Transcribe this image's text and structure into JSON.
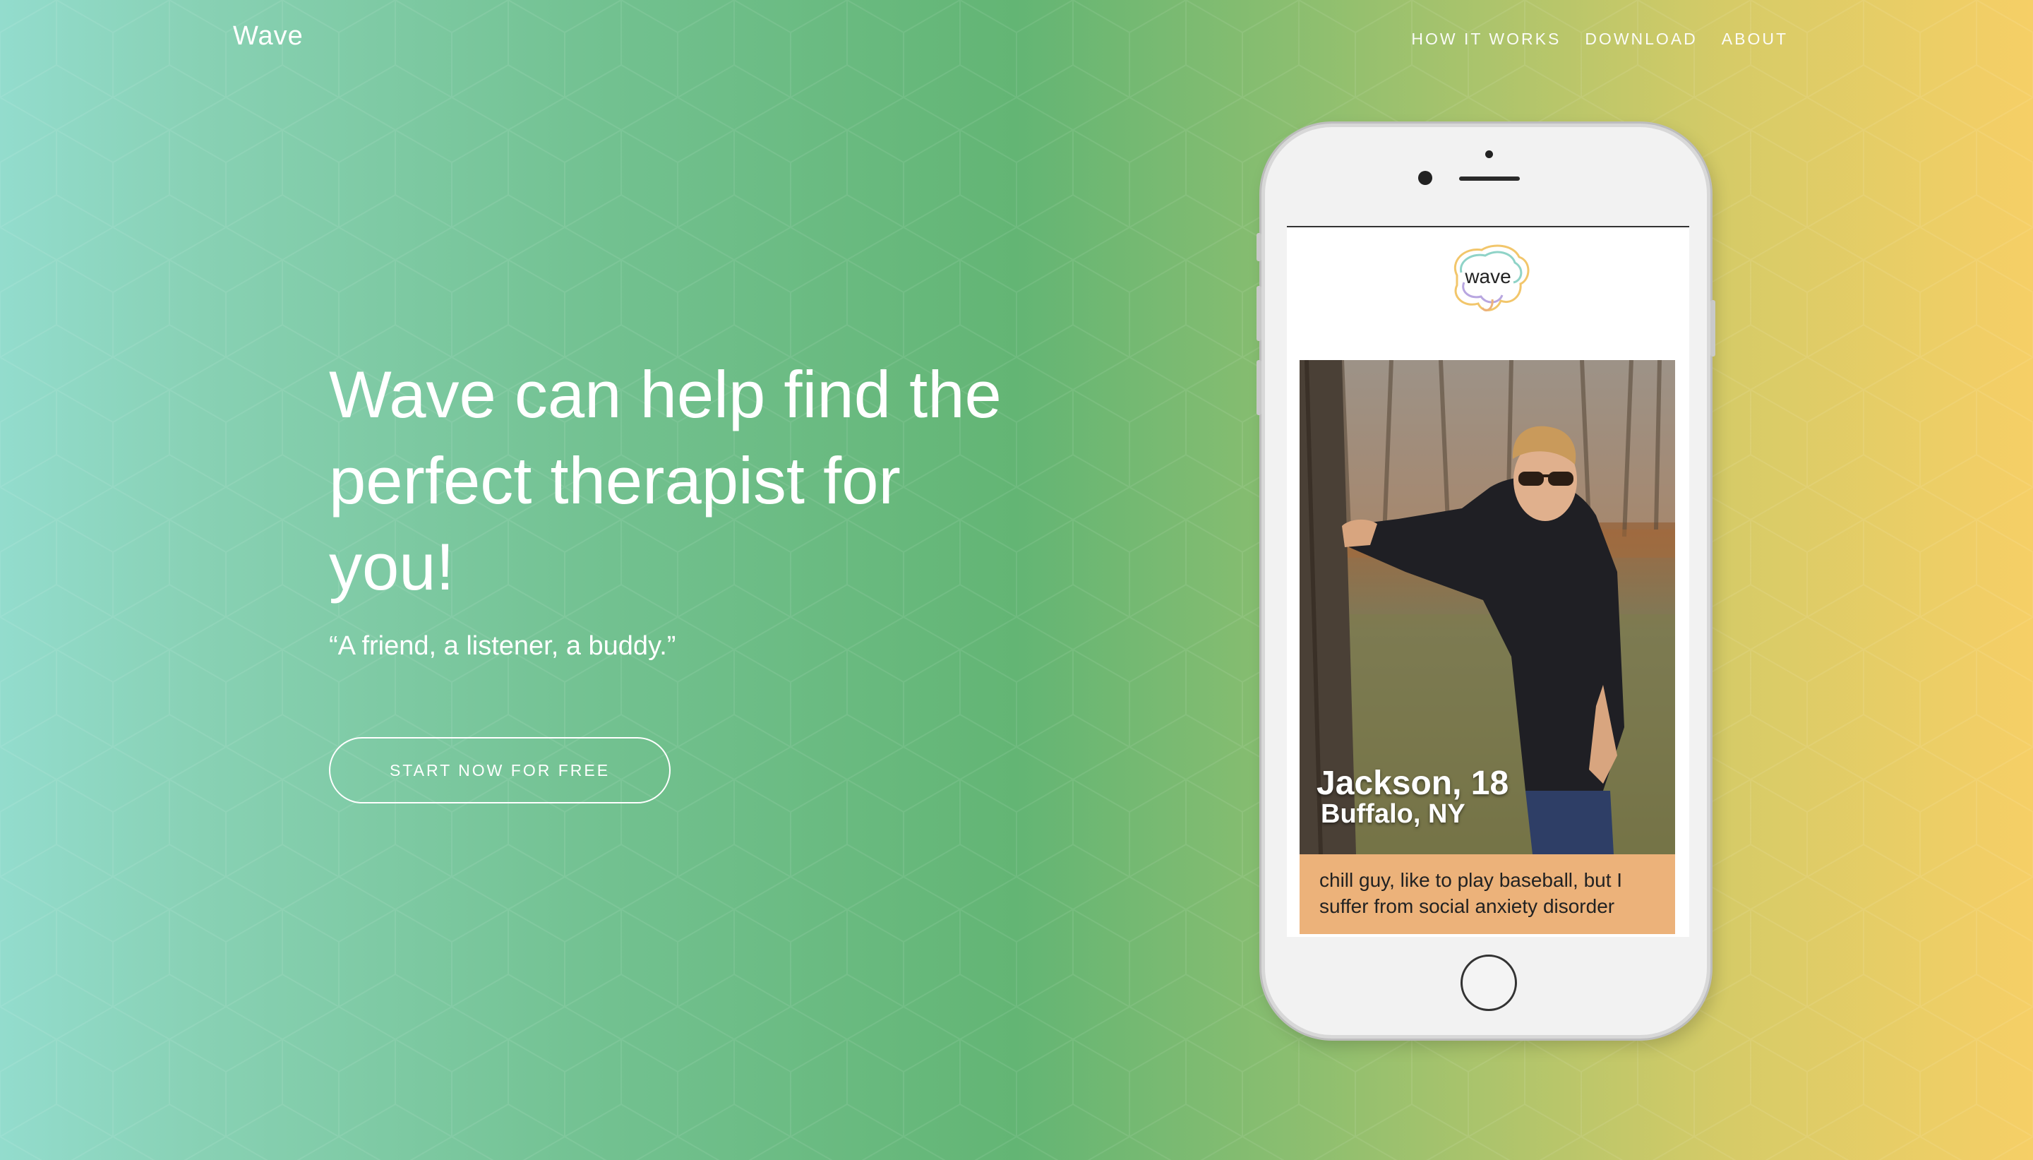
{
  "nav": {
    "brand": "Wave",
    "links": [
      "HOW IT WORKS",
      "DOWNLOAD",
      "ABOUT"
    ]
  },
  "hero": {
    "headline": "Wave can help find the perfect therapist for you!",
    "tagline": "“A friend, a listener, a buddy.”",
    "cta_label": "START NOW FOR FREE"
  },
  "phone": {
    "app_logo_text": "wave",
    "profile": {
      "name_age": "Jackson, 18",
      "location": "Buffalo, NY",
      "bio": "chill guy, like to play baseball, but I suffer from social anxiety disorder"
    }
  },
  "colors": {
    "gradient_left": "#93dccd",
    "gradient_mid": "#63b574",
    "gradient_right": "#f6cf66",
    "bio_background": "#ecb27a",
    "text": "#ffffff"
  }
}
